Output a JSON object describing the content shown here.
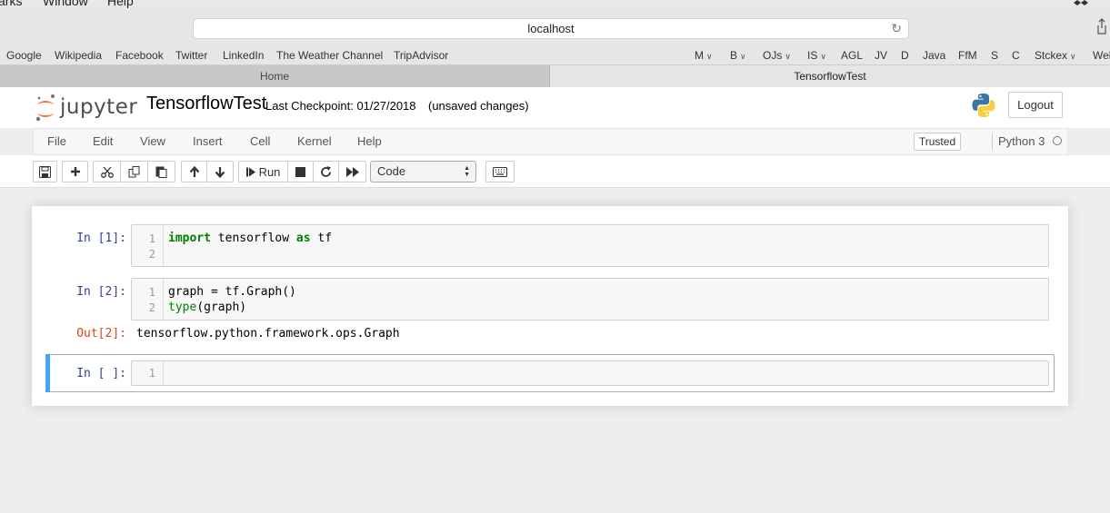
{
  "os_menu": {
    "items": [
      "arks",
      "Window",
      "Help"
    ]
  },
  "browser": {
    "url": "localhost",
    "bookmarks": [
      {
        "label": "Google"
      },
      {
        "label": "Wikipedia"
      },
      {
        "label": "Facebook"
      },
      {
        "label": "Twitter"
      },
      {
        "label": "LinkedIn"
      },
      {
        "label": "The Weather Channel"
      },
      {
        "label": "TripAdvisor"
      },
      {
        "label": "M"
      },
      {
        "label": "B"
      },
      {
        "label": "OJs"
      },
      {
        "label": "IS"
      },
      {
        "label": "AGL"
      },
      {
        "label": "JV"
      },
      {
        "label": "D"
      },
      {
        "label": "Java"
      },
      {
        "label": "FfM"
      },
      {
        "label": "S"
      },
      {
        "label": "C"
      },
      {
        "label": "Stckex"
      },
      {
        "label": "Wel"
      }
    ],
    "tabs": [
      {
        "label": "Home"
      },
      {
        "label": "TensorflowTest"
      }
    ]
  },
  "jupyter": {
    "logo_text": "jupyter",
    "notebook_name": "TensorflowTest",
    "checkpoint": "Last Checkpoint: 01/27/2018",
    "unsaved": "(unsaved changes)",
    "logout_label": "Logout",
    "menu": [
      "File",
      "Edit",
      "View",
      "Insert",
      "Cell",
      "Kernel",
      "Help"
    ],
    "trusted_label": "Trusted",
    "kernel_name": "Python 3",
    "run_label": "Run",
    "cell_type": "Code"
  },
  "cells": [
    {
      "prompt": "In [1]:",
      "line_numbers": [
        "1",
        "2"
      ],
      "code": [
        {
          "kw": "import",
          "rest1": " tensorflow ",
          "kw2": "as",
          "rest2": " tf"
        }
      ]
    },
    {
      "prompt": "In [2]:",
      "line_numbers": [
        "1",
        "2"
      ],
      "line1": "graph = tf.Graph()",
      "line2_builtin": "type",
      "line2_rest": "(graph)",
      "out_prompt": "Out[2]:",
      "output": "tensorflow.python.framework.ops.Graph"
    },
    {
      "prompt": "In [ ]:",
      "line_numbers": [
        "1"
      ]
    }
  ],
  "colors": {
    "prompt_in": "#303f9f",
    "prompt_out": "#d84315",
    "keyword": "#008000",
    "selected_cell_bar": "#42a5f5"
  }
}
